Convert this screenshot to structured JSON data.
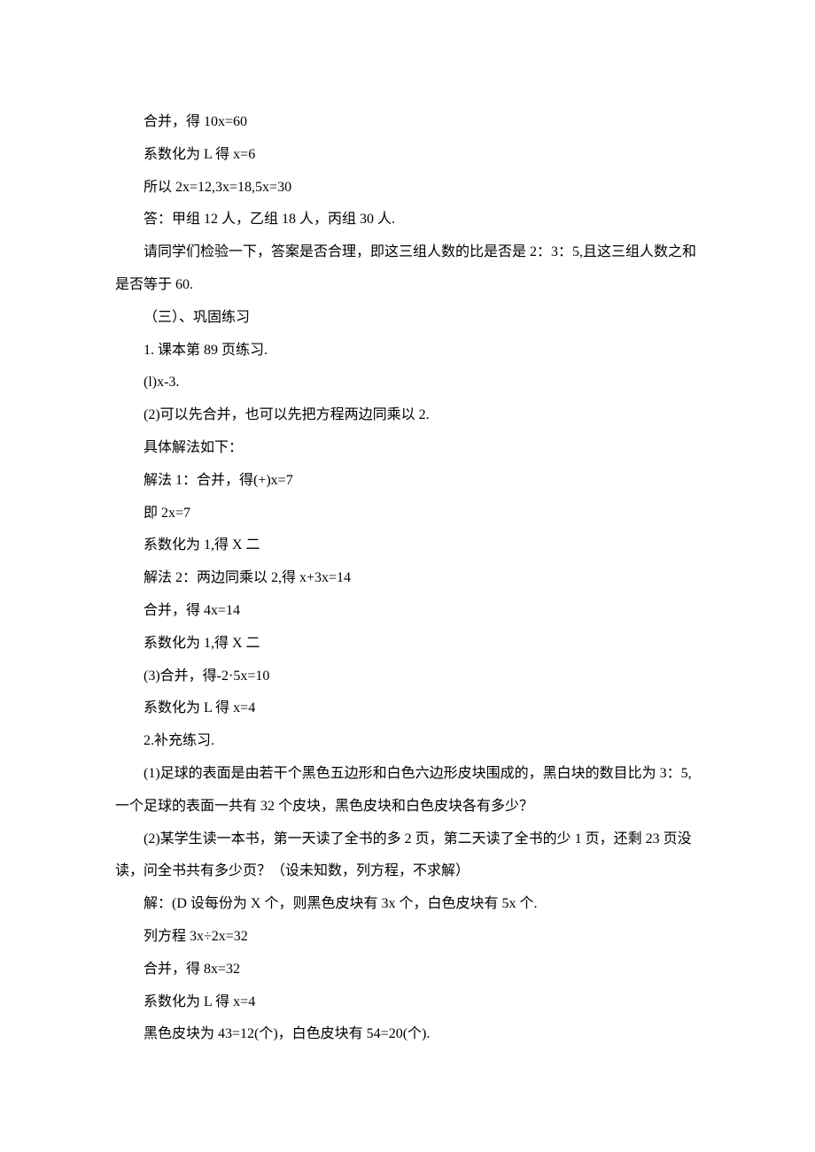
{
  "lines": [
    {
      "text": "合并，得 10x=60",
      "indent": true
    },
    {
      "text": "系数化为 L 得 x=6",
      "indent": true
    },
    {
      "text": "所以 2x=12,3x=18,5x=30",
      "indent": true
    },
    {
      "text": "答：甲组 12 人，乙组 18 人，丙组 30 人.",
      "indent": true
    },
    {
      "text": "请同学们检验一下，答案是否合理，即这三组人数的比是否是 2：3：5,且这三组人数之和是否等于 60.",
      "indent": true,
      "hang": true
    },
    {
      "text": "（三）、巩固练习",
      "indent": true
    },
    {
      "text": "1. 课本第 89 页练习.",
      "indent": true
    },
    {
      "text": "(l)x-3.",
      "indent": true
    },
    {
      "text": "(2)可以先合并，也可以先把方程两边同乘以 2.",
      "indent": true
    },
    {
      "text": "具体解法如下：",
      "indent": true
    },
    {
      "text": "解法 1：合并，得(+)x=7",
      "indent": true
    },
    {
      "text": "即 2x=7",
      "indent": true
    },
    {
      "text": "系数化为 1,得 X 二",
      "indent": true
    },
    {
      "text": "解法 2：两边同乘以 2,得 x+3x=14",
      "indent": true
    },
    {
      "text": "合并，得 4x=14",
      "indent": true
    },
    {
      "text": "系数化为 1,得 X 二",
      "indent": true
    },
    {
      "text": "(3)合并，得-2·5x=10",
      "indent": true
    },
    {
      "text": "系数化为 L 得 x=4",
      "indent": true
    },
    {
      "text": "2.补充练习.",
      "indent": true
    },
    {
      "text": "(1)足球的表面是由若干个黑色五边形和白色六边形皮块围成的，黑白块的数目比为 3：5,一个足球的表面一共有 32 个皮块，黑色皮块和白色皮块各有多少？",
      "indent": true,
      "hang": true
    },
    {
      "text": "(2)某学生读一本书，第一天读了全书的多 2 页，第二天读了全书的少 1 页，还剩 23 页没读，问全书共有多少页？（设未知数，列方程，不求解）",
      "indent": true,
      "hang": true
    },
    {
      "text": "解：(D 设每份为 X 个，则黑色皮块有 3x 个，白色皮块有 5x 个.",
      "indent": true
    },
    {
      "text": "列方程 3x÷2x=32",
      "indent": true
    },
    {
      "text": "合并，得 8x=32",
      "indent": true
    },
    {
      "text": "系数化为 L 得 x=4",
      "indent": true
    },
    {
      "text": "黑色皮块为 43=12(个)，白色皮块有 54=20(个).",
      "indent": true
    }
  ]
}
